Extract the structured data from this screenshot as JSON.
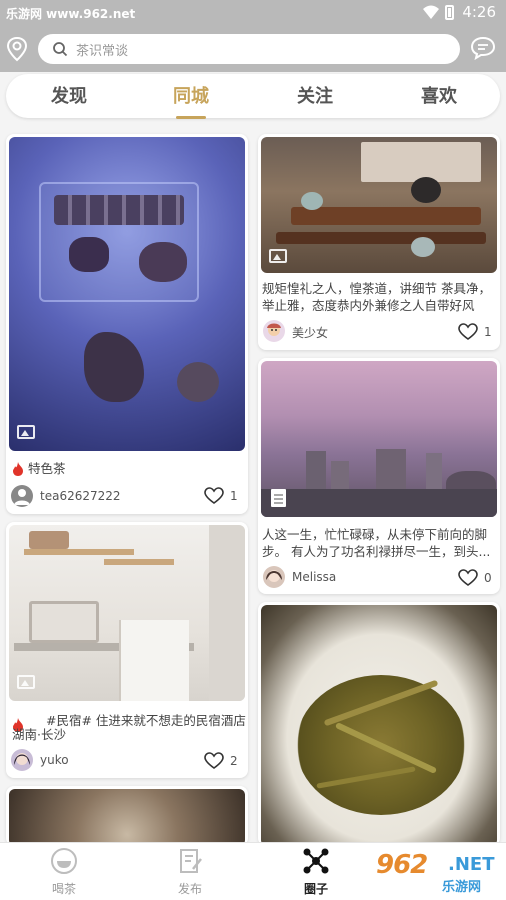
{
  "status_bar": {
    "left_text": "乐游网 www.962.net",
    "time": "4:26"
  },
  "search": {
    "placeholder": "茶识常谈"
  },
  "tabs": [
    {
      "label": "发现",
      "active": false
    },
    {
      "label": "同城",
      "active": true
    },
    {
      "label": "关注",
      "active": false
    },
    {
      "label": "喜欢",
      "active": false
    }
  ],
  "posts": [
    {
      "title": "特色茶",
      "user": "tea62627222",
      "likes": "1"
    },
    {
      "title": "规矩惶礼之人，惶茶道，讲细节 茶具净，举止雅，态度恭内外兼修之人自带好风水...",
      "user": "美少女",
      "likes": "1"
    },
    {
      "title": "人这一生，忙忙碌碌，从未停下前向的脚步。 有人为了功名利禄拼尽一生，到头...",
      "user": "Melissa",
      "likes": "0"
    },
    {
      "title": "#民宿# 住进来就不想走的民宿酒店",
      "location": "湖南·长沙",
      "user": "yuko",
      "likes": "2"
    }
  ],
  "bottom_nav": [
    {
      "label": "喝茶",
      "active": false
    },
    {
      "label": "发布",
      "active": false
    },
    {
      "label": "圈子",
      "active": true
    }
  ],
  "watermark": {
    "big": "962",
    "net": ".NET",
    "sub": "乐游网"
  },
  "colors": {
    "accent": "#c7a45b",
    "topbar": "#b9b9b9",
    "fire": "#e0342a"
  }
}
